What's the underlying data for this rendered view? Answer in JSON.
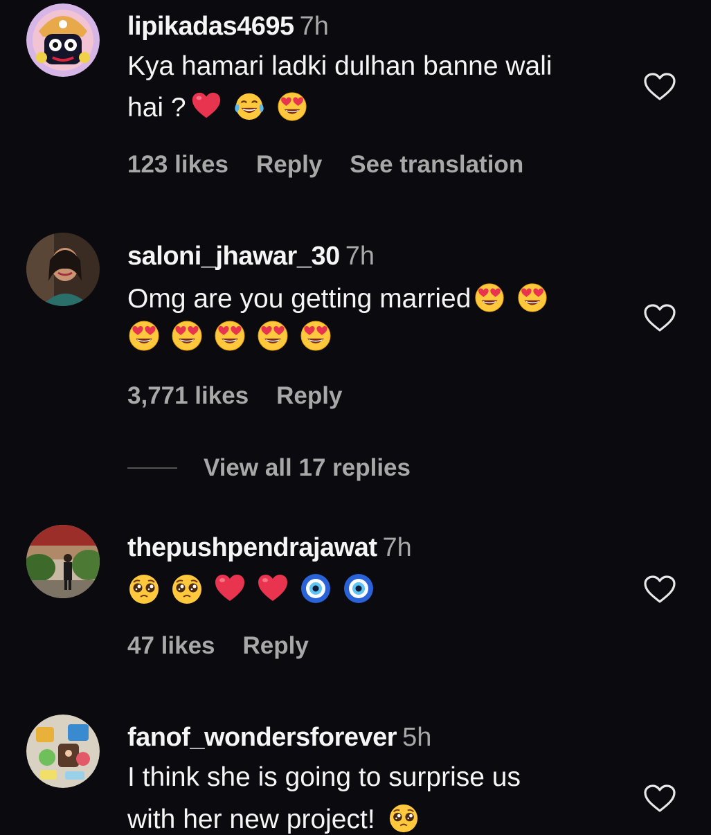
{
  "comments": [
    {
      "username": "lipikadas4695",
      "time": "7h",
      "text_line1": "Kya hamari ladki dulhan banne wali",
      "text_line2": "hai ?",
      "likes": "123 likes",
      "reply": "Reply",
      "translation": "See translation",
      "emojis": [
        "red-heart",
        "face-with-tears-of-joy",
        "smiling-face-with-heart-eyes"
      ]
    },
    {
      "username": "saloni_jhawar_30",
      "time": "7h",
      "text_line1": "Omg are you getting married",
      "likes": "3,771 likes",
      "reply": "Reply",
      "view_replies": "View all 17 replies",
      "emojis": [
        "smiling-face-with-heart-eyes",
        "smiling-face-with-heart-eyes",
        "smiling-face-with-heart-eyes",
        "smiling-face-with-heart-eyes",
        "smiling-face-with-heart-eyes",
        "smiling-face-with-heart-eyes",
        "smiling-face-with-heart-eyes"
      ]
    },
    {
      "username": "thepushpendrajawat",
      "time": "7h",
      "likes": "47 likes",
      "reply": "Reply",
      "emojis": [
        "pleading-face",
        "pleading-face",
        "red-heart",
        "red-heart",
        "nazar-amulet",
        "nazar-amulet"
      ]
    },
    {
      "username": "fanof_wondersforever",
      "time": "5h",
      "text_line1": "I think she is going to surprise us",
      "text_line2": "with her new project!",
      "emojis": [
        "pleading-face"
      ]
    }
  ],
  "icons": {
    "like": "heart-outline-icon"
  },
  "colors": {
    "background": "#0b0b0f",
    "text": "#f5f5f5",
    "muted": "#a8a8a8"
  }
}
